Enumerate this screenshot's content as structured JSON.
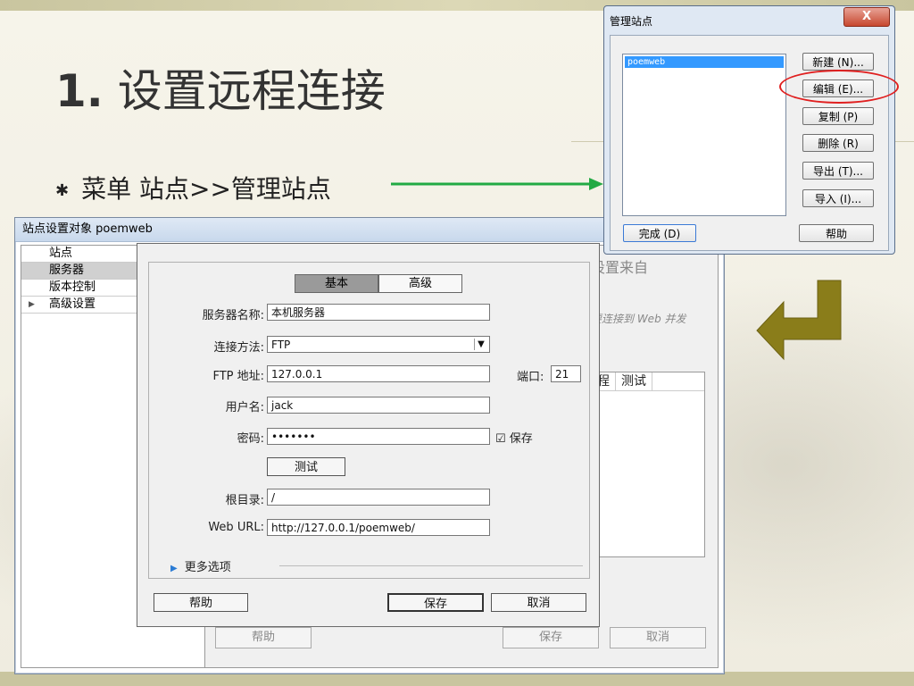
{
  "slide": {
    "title_num": "1.",
    "title_text": " 设置远程连接",
    "bullet_star": "✱",
    "bullet_text": "菜单 站点>>管理站点"
  },
  "colors": {
    "accent_green": "#22aa44",
    "arrow_olive": "#8a7d1a",
    "highlight_red": "#e02020"
  },
  "back_window": {
    "title": "站点设置对象 poemweb",
    "sidebar": [
      "站点",
      "服务器",
      "版本控制",
      "高级设置"
    ],
    "heading": "设置来自",
    "desc": "要连接到 Web 并发",
    "table_headers": [
      "程",
      "测试"
    ],
    "buttons": {
      "help": "帮助",
      "save": "保存",
      "cancel": "取消"
    }
  },
  "server_dialog": {
    "tabs": [
      "基本",
      "高级"
    ],
    "fields": {
      "server_name_label": "服务器名称:",
      "server_name": "本机服务器",
      "connect_label": "连接方法:",
      "connect": "FTP",
      "ftp_label": "FTP 地址:",
      "ftp": "127.0.0.1",
      "port_label": "端口:",
      "port": "21",
      "user_label": "用户名:",
      "user": "jack",
      "pwd_label": "密码:",
      "pwd": "•••••••",
      "save_check": "保存",
      "test": "测试",
      "root_label": "根目录:",
      "root": "/",
      "url_label": "Web URL:",
      "url": "http://127.0.0.1/poemweb/"
    },
    "more": "更多选项",
    "buttons": {
      "help": "帮助",
      "save": "保存",
      "cancel": "取消"
    }
  },
  "manage_dialog": {
    "title": "管理站点",
    "close": "X",
    "sites": [
      "poemweb"
    ],
    "buttons": [
      "新建 (N)...",
      "编辑 (E)...",
      "复制 (P)",
      "删除 (R)",
      "导出 (T)...",
      "导入 (I)..."
    ],
    "done": "完成 (D)",
    "help": "帮助"
  }
}
